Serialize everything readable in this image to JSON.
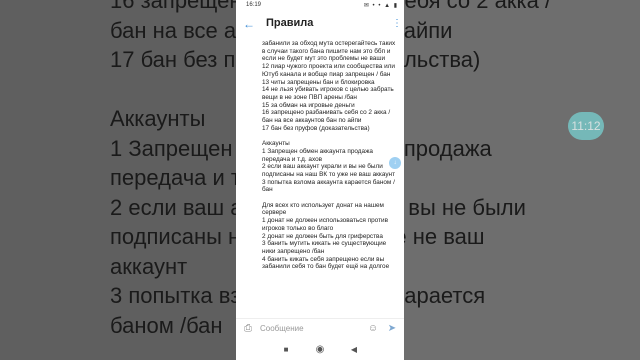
{
  "status_bar": {
    "time": "16:19",
    "icons": "✉ • • ▲ ▮"
  },
  "header": {
    "title": "Правила",
    "back_glyph": "←",
    "menu_glyph": "⋮"
  },
  "message_lines": [
    "забанили за обход мута остерегайтесь таких в случаи такого бана пишите нам это ббп и если не будет мут это проблемы не ваши",
    "12 пиар чужого проекта или сообщества или Ютуб канала и вобще пиар запрещен / бан",
    "13 читы запрещены бан и блокировка",
    "14 не льзя убивать игроков с целью забрать вещи в не зоне ПВП арены /бан",
    "15 за обман на игровые деньги",
    "16 запрещено разбанивать себя со 2 акка / бан на все аккаунтов бан по айпи",
    "17 бан без пруфов (доказательства)",
    "",
    "Аккаунты",
    "1 Запрещен обмен аккаунта продажа передача и т.д. ахов",
    "2 если ваш аккаунт украли и вы не были подписаны на наш ВК то уже не ваш аккаунт",
    "3 попытка взлома аккаунта карается баном /бан",
    "",
    "Для всех кто использует донат на нашем сервере",
    "1 донат не должен использоваться против игроков только во благо",
    "2 донат не должен быть для гриферства",
    "3 банить мутить кикать не существующие ники запрещено /бан",
    "4 банить кикать себя запрещено если вы забанили себя то бан будет ещё на долгое"
  ],
  "background_text": [
    "16 запрещено разбанивать себя со 2 акка /",
    "бан на все аккаунтов бан по айпи",
    "17 бан без пруфов (доказательства)",
    "",
    "Аккаунты",
    "1 Запрещен обмен аккаунта продажа",
    "передача и т.д. ахов",
    "2 если ваш аккаунт украли и вы не были",
    "подписаны на наш ВК то уже не ваш",
    "аккаунт",
    "3 попытка взлома аккаунта карается",
    "баном /бан"
  ],
  "background_time_bubble": "11:12",
  "scroll_fab_glyph": "↓",
  "input": {
    "placeholder": "Сообщение",
    "attach_glyph": "⎙",
    "emoji_glyph": "☺",
    "send_glyph": "➤"
  },
  "nav": {
    "stop": "■",
    "home": "◉",
    "back": "◀"
  },
  "colors": {
    "accent": "#3d8cd6",
    "fab": "#9fd0f2",
    "time_bubble": "#77c6c6"
  }
}
